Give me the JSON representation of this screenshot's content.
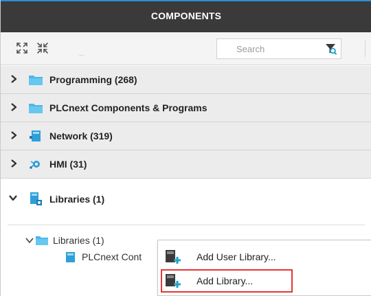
{
  "panel": {
    "title": "COMPONENTS"
  },
  "toolbar": {
    "expand_icon": "expand-all-icon",
    "collapse_icon": "collapse-all-icon",
    "search_placeholder": "Search",
    "filter_icon": "filter-icon"
  },
  "sections": [
    {
      "label": "Programming (268)",
      "icon": "folder-icon",
      "expanded": false
    },
    {
      "label": "PLCnext Components & Programs",
      "icon": "folder-icon",
      "expanded": false
    },
    {
      "label": "Network (319)",
      "icon": "network-icon",
      "expanded": false
    },
    {
      "label": "HMI (31)",
      "icon": "hmi-icon",
      "expanded": false
    },
    {
      "label": "Libraries (1)",
      "icon": "libraries-icon",
      "expanded": true
    }
  ],
  "libraries_tree": {
    "folder_label": "Libraries (1)",
    "item_label": "PLCnext Cont"
  },
  "context_menu": {
    "items": [
      {
        "label": "Add User Library...",
        "icon": "add-library-icon",
        "highlighted": false
      },
      {
        "label": "Add Library...",
        "icon": "add-library-icon",
        "highlighted": true
      }
    ]
  },
  "colors": {
    "header_bg": "#3a3a3a",
    "accent": "#2b8ed6",
    "folder": "#4fb6e8",
    "highlight_border": "#e53535"
  }
}
